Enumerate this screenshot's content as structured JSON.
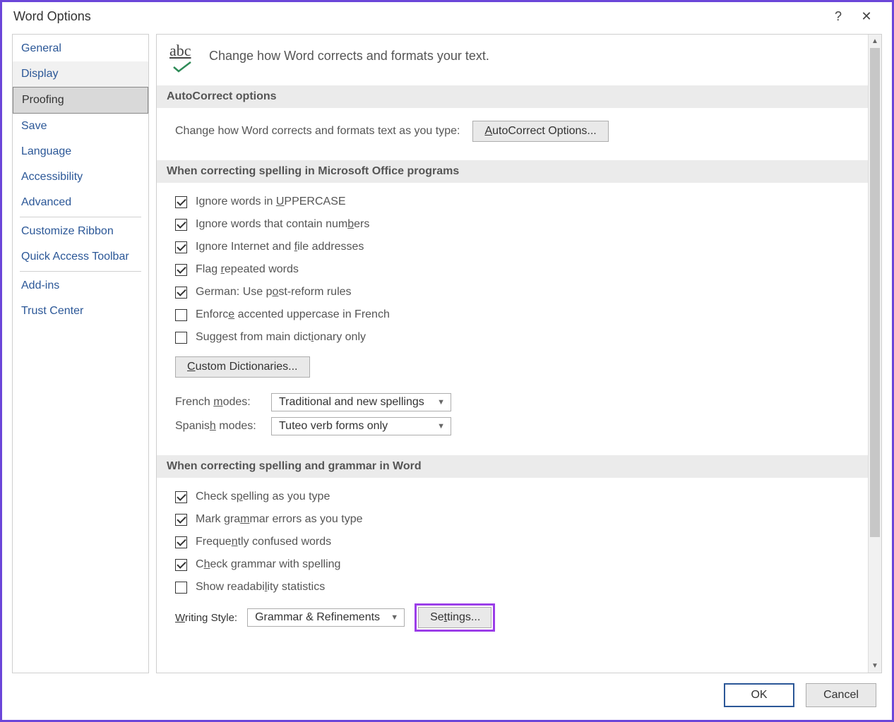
{
  "title": "Word Options",
  "help_glyph": "?",
  "close_glyph": "✕",
  "sidebar": {
    "items": [
      {
        "label": "General"
      },
      {
        "label": "Display"
      },
      {
        "label": "Proofing"
      },
      {
        "label": "Save"
      },
      {
        "label": "Language"
      },
      {
        "label": "Accessibility"
      },
      {
        "label": "Advanced"
      },
      {
        "label": "Customize Ribbon"
      },
      {
        "label": "Quick Access Toolbar"
      },
      {
        "label": "Add-ins"
      },
      {
        "label": "Trust Center"
      }
    ]
  },
  "header": {
    "abc": "abc",
    "text": "Change how Word corrects and formats your text."
  },
  "autocorrect": {
    "section_title": "AutoCorrect options",
    "prompt": "Change how Word corrects and formats text as you type:",
    "button_pre": "A",
    "button_post": "utoCorrect Options..."
  },
  "spelling": {
    "section_title": "When correcting spelling in Microsoft Office programs",
    "opts": [
      {
        "pre": "Ignore words in ",
        "u": "U",
        "post": "PPERCASE",
        "checked": true
      },
      {
        "pre": "Ignore words that contain num",
        "u": "b",
        "post": "ers",
        "checked": true
      },
      {
        "pre": "Ignore Internet and ",
        "u": "f",
        "post": "ile addresses",
        "checked": true
      },
      {
        "pre": "Flag ",
        "u": "r",
        "post": "epeated words",
        "checked": true
      },
      {
        "pre": "German: Use p",
        "u": "o",
        "post": "st-reform rules",
        "checked": true
      },
      {
        "pre": "Enforc",
        "u": "e",
        "post": " accented uppercase in French",
        "checked": false
      },
      {
        "pre": "Suggest from main dict",
        "u": "i",
        "post": "onary only",
        "checked": false
      }
    ],
    "custom_btn_pre": "C",
    "custom_btn_post": "ustom Dictionaries...",
    "french_label_pre": "French ",
    "french_label_u": "m",
    "french_label_post": "odes:",
    "french_value": "Traditional and new spellings",
    "spanish_label_pre": "Spanis",
    "spanish_label_u": "h",
    "spanish_label_post": " modes:",
    "spanish_value": "Tuteo verb forms only"
  },
  "grammar": {
    "section_title": "When correcting spelling and grammar in Word",
    "opts": [
      {
        "pre": "Check s",
        "u": "p",
        "post": "elling as you type",
        "checked": true
      },
      {
        "pre": "Mark gra",
        "u": "m",
        "post": "mar errors as you type",
        "checked": true
      },
      {
        "pre": "Freque",
        "u": "n",
        "post": "tly confused words",
        "checked": true
      },
      {
        "pre": "C",
        "u": "h",
        "post": "eck grammar with spelling",
        "checked": true
      },
      {
        "pre": "Show readabi",
        "u": "l",
        "post": "ity statistics",
        "checked": false
      }
    ],
    "writing_label_pre": "W",
    "writing_label_post": "riting Style:",
    "writing_value": "Grammar & Refinements",
    "settings_btn_pre": "Se",
    "settings_btn_u": "t",
    "settings_btn_post": "tings..."
  },
  "footer": {
    "ok": "OK",
    "cancel": "Cancel"
  },
  "icons": {
    "up": "▲",
    "down": "▼",
    "caret": "▼"
  }
}
